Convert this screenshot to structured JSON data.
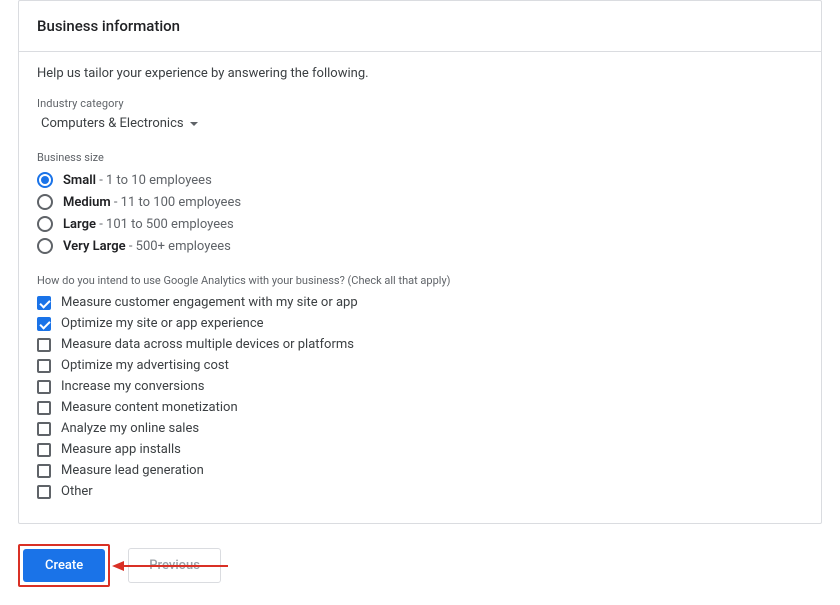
{
  "header": {
    "title": "Business information"
  },
  "intro": "Help us tailor your experience by answering the following.",
  "industry": {
    "label": "Industry category",
    "value": "Computers & Electronics"
  },
  "businessSize": {
    "label": "Business size",
    "options": [
      {
        "name": "Small",
        "detail": " - 1 to 10 employees",
        "selected": true
      },
      {
        "name": "Medium",
        "detail": " - 11 to 100 employees",
        "selected": false
      },
      {
        "name": "Large",
        "detail": " - 101 to 500 employees",
        "selected": false
      },
      {
        "name": "Very Large",
        "detail": " - 500+ employees",
        "selected": false
      }
    ]
  },
  "usage": {
    "label": "How do you intend to use Google Analytics with your business? (Check all that apply)",
    "options": [
      {
        "label": "Measure customer engagement with my site or app",
        "checked": true
      },
      {
        "label": "Optimize my site or app experience",
        "checked": true
      },
      {
        "label": "Measure data across multiple devices or platforms",
        "checked": false
      },
      {
        "label": "Optimize my advertising cost",
        "checked": false
      },
      {
        "label": "Increase my conversions",
        "checked": false
      },
      {
        "label": "Measure content monetization",
        "checked": false
      },
      {
        "label": "Analyze my online sales",
        "checked": false
      },
      {
        "label": "Measure app installs",
        "checked": false
      },
      {
        "label": "Measure lead generation",
        "checked": false
      },
      {
        "label": "Other",
        "checked": false
      }
    ]
  },
  "buttons": {
    "create": "Create",
    "previous": "Previous"
  }
}
